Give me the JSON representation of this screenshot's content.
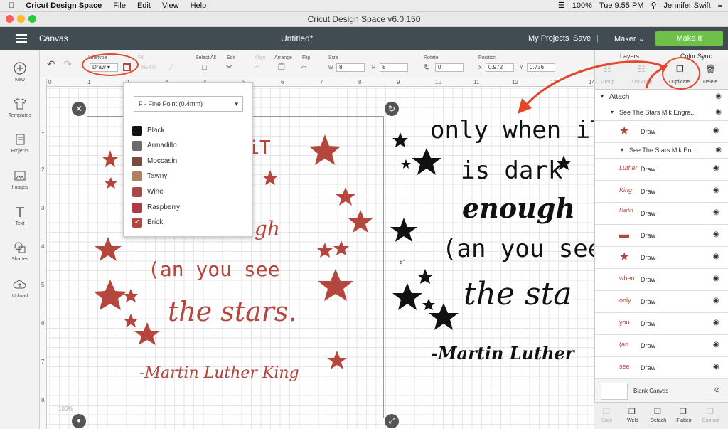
{
  "mac": {
    "app": "Cricut Design Space",
    "menu": [
      "File",
      "Edit",
      "View",
      "Help"
    ],
    "battery": "100%",
    "time": "Tue 9:55 PM",
    "user": "Jennifer Swift"
  },
  "window_title": "Cricut Design Space  v6.0.150",
  "nav": {
    "canvas": "Canvas",
    "doc": "Untitled*",
    "my_projects": "My Projects",
    "save": "Save",
    "sep": "|",
    "maker": "Maker",
    "make_it": "Make It"
  },
  "toolbar": {
    "linetype_label": "Linetype",
    "linetype_value": "Draw",
    "fill_label": "Fill",
    "fill_value": "No Fill",
    "select_all": "Select All",
    "edit": "Edit",
    "align": "Align",
    "arrange": "Arrange",
    "flip": "Flip",
    "size": "Size",
    "w_label": "W",
    "w_value": "8",
    "h_label": "H",
    "h_value": "8",
    "rotate": "Rotate",
    "rotate_value": "0",
    "position": "Position",
    "x_label": "X",
    "x_value": "0.972",
    "y_label": "Y",
    "y_value": "0.736"
  },
  "left_menu": [
    {
      "label": "New"
    },
    {
      "label": "Templates"
    },
    {
      "label": "Projects"
    },
    {
      "label": "Images"
    },
    {
      "label": "Text"
    },
    {
      "label": "Shapes"
    },
    {
      "label": "Upload"
    }
  ],
  "ruler_top": [
    "0",
    "1",
    "2",
    "3",
    "4",
    "5",
    "6",
    "7",
    "8",
    "9",
    "10",
    "11",
    "12",
    "13",
    "14"
  ],
  "ruler_left": [
    "1",
    "2",
    "3",
    "4",
    "5",
    "6",
    "7",
    "8"
  ],
  "dropdown": {
    "pen": "F - Fine Point (0.4mm)",
    "colors": [
      {
        "name": "Black",
        "hex": "#111111"
      },
      {
        "name": "Armadillo",
        "hex": "#6c6c6c"
      },
      {
        "name": "Moccasin",
        "hex": "#7a4a3a"
      },
      {
        "name": "Tawny",
        "hex": "#b08060"
      },
      {
        "name": "Wine",
        "hex": "#a84848"
      },
      {
        "name": "Raspberry",
        "hex": "#b03a48"
      },
      {
        "name": "Brick",
        "hex": "#b4463e"
      }
    ]
  },
  "quote_left": {
    "l1": "n iT",
    "l2": "gh",
    "l3": "(an you see",
    "l4": "the stars.",
    "l5": "-Martin Luther King"
  },
  "quote_right": {
    "l1": "only when iT",
    "l2": "is dark",
    "l3": "enough",
    "l4": "(an you see",
    "l5": "the sta",
    "l6": "-Martin Luther"
  },
  "canvas_label": "8\"",
  "zoom": "100%",
  "panel": {
    "tab_layers": "Layers",
    "tab_sync": "Color Sync",
    "group": "Group",
    "ungroup": "UnGroup",
    "duplicate": "Duplicate",
    "delete": "Delete",
    "attach": "Attach",
    "group1": "See The Stars Mlk Engra...",
    "group2": "See The Stars Mlk En...",
    "blank_canvas": "Blank Canvas",
    "layers": [
      {
        "thumb": "★",
        "name": "Draw"
      },
      {
        "thumb": "Luther",
        "name": "Draw"
      },
      {
        "thumb": "King",
        "name": "Draw"
      },
      {
        "thumb": "Martin",
        "name": "Draw"
      },
      {
        "thumb": "▬",
        "name": "Draw"
      },
      {
        "thumb": "★",
        "name": "Draw"
      },
      {
        "thumb": "when",
        "name": "Draw"
      },
      {
        "thumb": "only",
        "name": "Draw"
      },
      {
        "thumb": "you",
        "name": "Draw"
      },
      {
        "thumb": "(an",
        "name": "Draw"
      },
      {
        "thumb": "see",
        "name": "Draw"
      }
    ],
    "bottom": [
      "Slice",
      "Weld",
      "Detach",
      "Flatten",
      "Contour"
    ]
  }
}
